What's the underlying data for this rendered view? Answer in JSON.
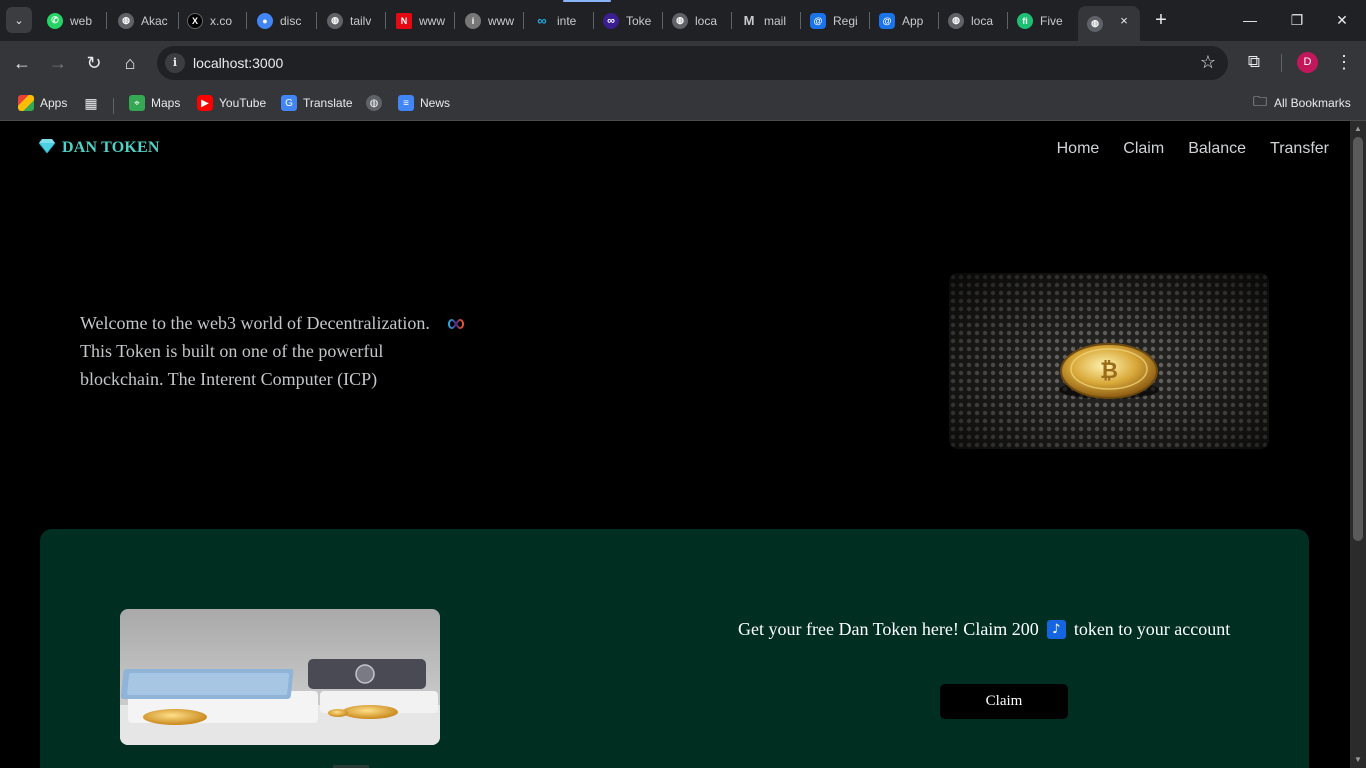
{
  "browser": {
    "tabs": [
      {
        "label": "web",
        "icon": "whatsapp-icon",
        "color": "#25d366"
      },
      {
        "label": "Akac",
        "icon": "globe-icon",
        "color": "#9aa0a6"
      },
      {
        "label": "x.co",
        "icon": "x-icon",
        "color": "#000000"
      },
      {
        "label": "disc",
        "icon": "chrome-icon",
        "color": "#4285f4"
      },
      {
        "label": "tailv",
        "icon": "globe-icon",
        "color": "#9aa0a6"
      },
      {
        "label": "www",
        "icon": "netflix-icon",
        "color": "#e50914"
      },
      {
        "label": "www",
        "icon": "info-icon",
        "color": "#9aa0a6"
      },
      {
        "label": "inte",
        "icon": "infinity-icon",
        "color": "#29abe2"
      },
      {
        "label": "Toke",
        "icon": "infinity-icon",
        "color": "#3b1e8f"
      },
      {
        "label": "loca",
        "icon": "globe-icon",
        "color": "#9aa0a6"
      },
      {
        "label": "mail",
        "icon": "gmail-icon",
        "color": "#9aa0a6"
      },
      {
        "label": "Regi",
        "icon": "meta-icon",
        "color": "#1a73e8"
      },
      {
        "label": "App",
        "icon": "meta-icon",
        "color": "#1a73e8"
      },
      {
        "label": "loca",
        "icon": "globe-icon",
        "color": "#9aa0a6"
      },
      {
        "label": "Five",
        "icon": "fiverr-icon",
        "color": "#1dbf73"
      }
    ],
    "active_tab": {
      "icon": "globe-icon",
      "close": "×"
    },
    "url": "localhost:3000",
    "profile_initial": "D",
    "bookmarks": [
      {
        "label": "Apps",
        "icon": "apps-grid-icon"
      },
      {
        "label": "",
        "icon": "grid-icon"
      },
      {
        "label": "Maps",
        "icon": "maps-icon"
      },
      {
        "label": "YouTube",
        "icon": "youtube-icon"
      },
      {
        "label": "Translate",
        "icon": "translate-icon"
      },
      {
        "label": "",
        "icon": "globe-icon"
      },
      {
        "label": "News",
        "icon": "news-icon"
      }
    ],
    "all_bookmarks": "All Bookmarks"
  },
  "site": {
    "brand": "DAN TOKEN",
    "nav": [
      "Home",
      "Claim",
      "Balance",
      "Transfer"
    ],
    "hero": {
      "line1": "Welcome to the web3 world of Decentralization.",
      "line2": "This Token is built on one of the powerful",
      "line3": "blockchain. The Interent Computer (ICP)"
    },
    "claim": {
      "text_before": "Get your free Dan Token here! Claim 200",
      "text_after": "token to your account",
      "button": "Claim"
    }
  },
  "colors": {
    "brand": "#4fd1c5",
    "claim_panel": "#002f22",
    "page_bg": "#000000"
  }
}
